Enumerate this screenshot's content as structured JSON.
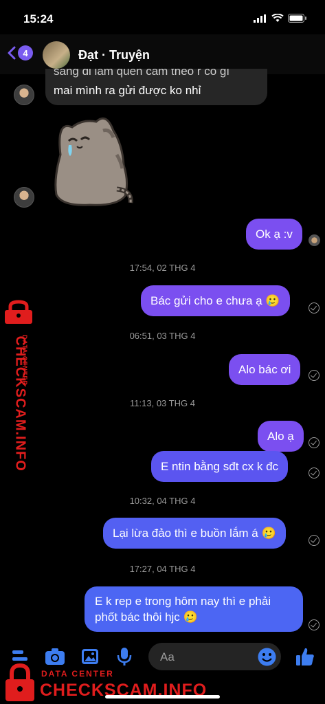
{
  "status": {
    "time": "15:24"
  },
  "header": {
    "unread_count": "4",
    "contact_name": "Đạt · Truyện"
  },
  "messages": {
    "incoming_partial": {
      "line1": "sáng đi làm quên cầm theo r có gì",
      "line2": "mai mình ra gửi được ko nhỉ"
    },
    "sticker": "crying-cat-sticker",
    "m1": "Ok ạ :v",
    "ts1": "17:54, 02 THG 4",
    "m2": "Bác gửi cho e chưa ạ 🥲",
    "ts2": "06:51, 03 THG 4",
    "m3": "Alo bác ơi",
    "ts3": "11:13, 03 THG 4",
    "m4": "Alo ạ",
    "m5": "E ntin bằng sđt cx k đc",
    "ts4": "10:32, 04 THG 4",
    "m6": "Lại lừa đảo thì e buồn lắm á 🥲",
    "ts5": "17:27, 04 THG 4",
    "m7_line1": "E k rep e trong hôm nay thì e phải",
    "m7_line2": "phốt bác thôi hjc 🥲"
  },
  "composer": {
    "placeholder": "Aa"
  },
  "watermark": {
    "label_small": "DATA CENTER",
    "label_large": "CHECKSCAM.INFO"
  },
  "colors": {
    "bubble_violet": "#7b4ff0",
    "bubble_indigo": "#5b55f0",
    "bubble_blue": "#4c66f3",
    "toolbar_icon": "#3d7df0",
    "watermark": "#e01d1d"
  }
}
